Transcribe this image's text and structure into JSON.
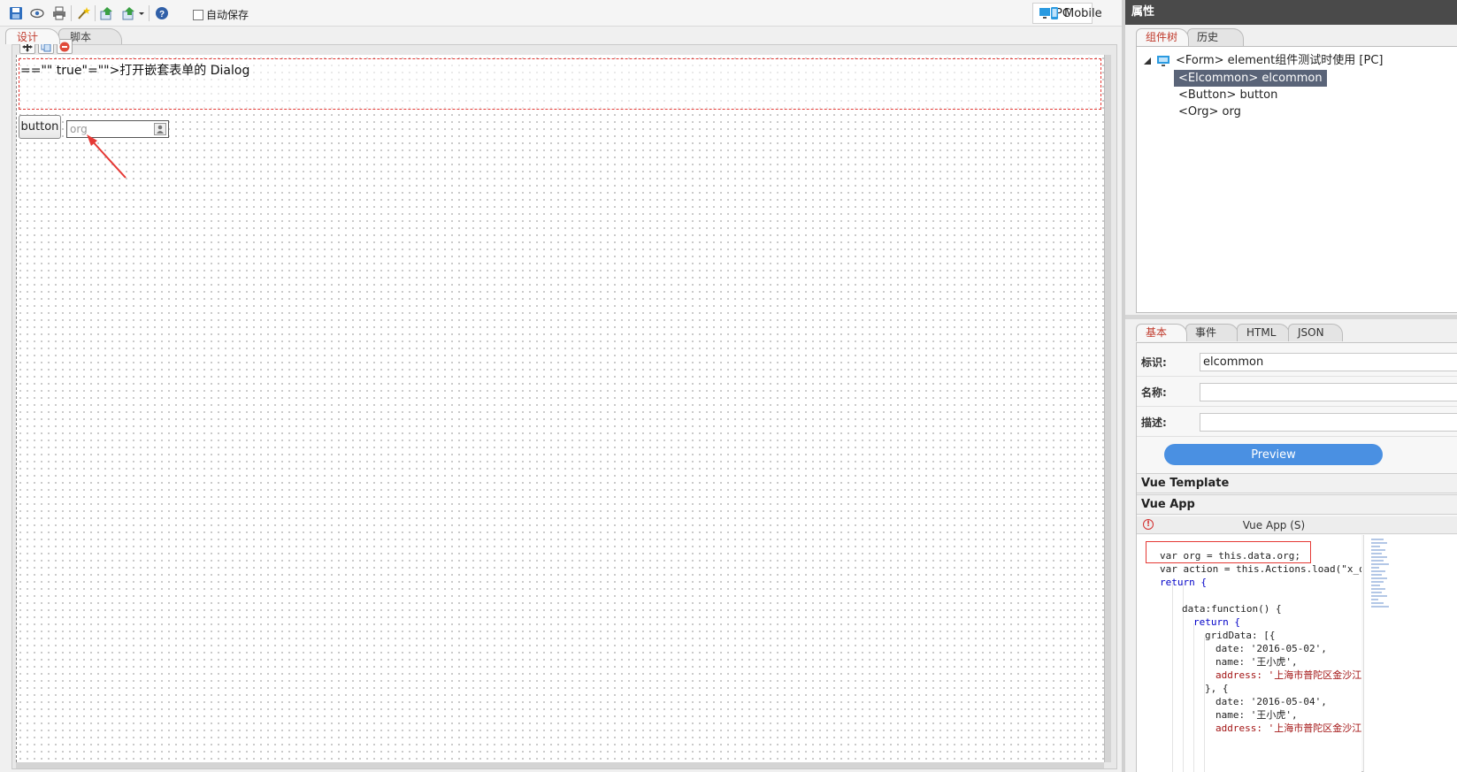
{
  "toolbar": {
    "autosave_label": "自动保存",
    "device_pc": "PC",
    "device_mobile": "Mobile"
  },
  "left_tabs": [
    "设计",
    "脚本"
  ],
  "canvas": {
    "elcommon_text": "==\"\" true\"=\"\">打开嵌套表单的 Dialog",
    "button_label": "button",
    "org_placeholder": "org"
  },
  "right_panel": {
    "title": "属性",
    "tree_tabs": [
      "组件树",
      "历史"
    ],
    "tree": {
      "root": "<Form> element组件测试时使用 [PC]",
      "items": [
        "<Elcommon> elcommon",
        "<Button> button",
        "<Org> org"
      ]
    },
    "prop_tabs": [
      "基本",
      "事件",
      "HTML",
      "JSON"
    ],
    "props": {
      "id_label": "标识:",
      "id_value": "elcommon",
      "name_label": "名称:",
      "name_value": "",
      "desc_label": "描述:",
      "desc_value": ""
    },
    "preview_label": "Preview",
    "sections": {
      "vue_template": "Vue Template",
      "vue_app": "Vue App",
      "code_title": "Vue App (S)"
    },
    "code_lines": [
      "var org = this.data.org;",
      "var action = this.Actions.load(\"x_qu",
      "return {",
      "",
      "data:function() {",
      "return {",
      "gridData: [{",
      "date: '2016-05-02',",
      "name: '王小虎',",
      "address: '上海市普陀区金沙江",
      "}, {",
      "date: '2016-05-04',",
      "name: '王小虎',",
      "address: '上海市普陀区金沙江"
    ]
  },
  "colors": {
    "accent_tab": "#c0392b",
    "selection": "#5a6478",
    "preview_button": "#4a90e2",
    "annotation_red": "#e53935"
  }
}
